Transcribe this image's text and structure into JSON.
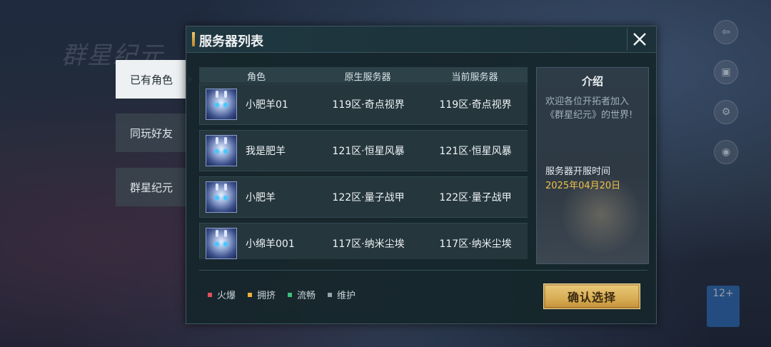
{
  "dialog": {
    "title": "服务器列表"
  },
  "side_tabs": [
    {
      "label": "已有角色",
      "active": true
    },
    {
      "label": "同玩好友",
      "active": false
    },
    {
      "label": "群星纪元",
      "active": false
    }
  ],
  "table": {
    "headers": [
      "角色",
      "原生服务器",
      "当前服务器"
    ],
    "rows": [
      {
        "name": "小肥羊01",
        "origin": "119区·奇点视界",
        "current": "119区·奇点视界"
      },
      {
        "name": "我是肥羊",
        "origin": "121区·恒星风暴",
        "current": "121区·恒星风暴"
      },
      {
        "name": "小肥羊",
        "origin": "122区·量子战甲",
        "current": "122区·量子战甲"
      },
      {
        "name": "小绵羊001",
        "origin": "117区·纳米尘埃",
        "current": "117区·纳米尘埃"
      }
    ]
  },
  "info": {
    "title": "介绍",
    "description": "欢迎各位开拓者加入《群星纪元》的世界!",
    "open_label": "服务器开服时间",
    "open_date": "2025年04月20日"
  },
  "legend": [
    {
      "label": "火爆",
      "color": "#e0505a"
    },
    {
      "label": "拥挤",
      "color": "#e8b13c"
    },
    {
      "label": "流畅",
      "color": "#3cc07a"
    },
    {
      "label": "维护",
      "color": "#9aa3a8"
    }
  ],
  "confirm_label": "确认选择"
}
